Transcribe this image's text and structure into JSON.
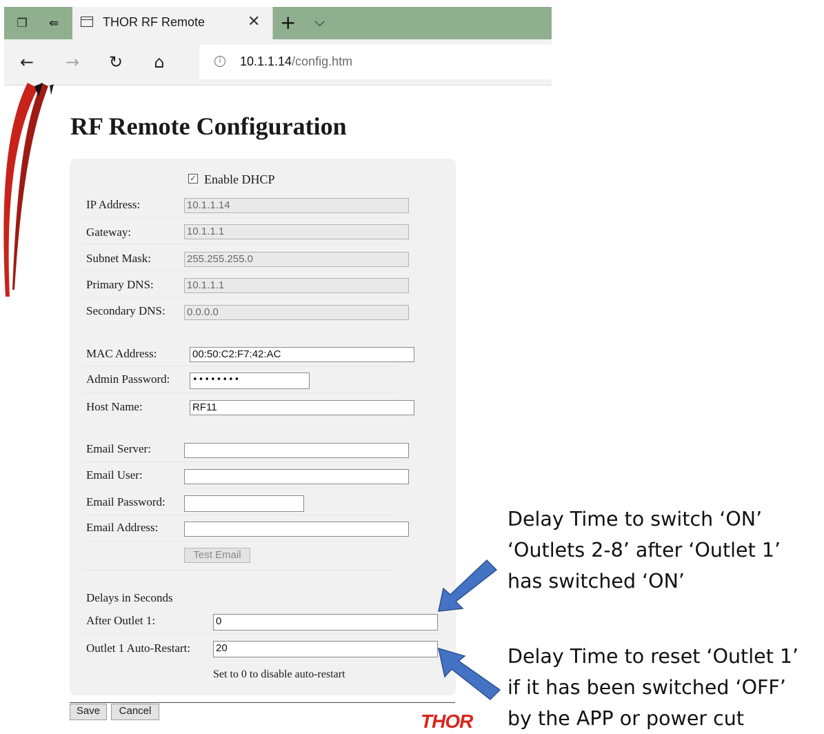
{
  "browser": {
    "tab_title": "THOR RF Remote",
    "url_host": "10.1.1.14",
    "url_path": "/config.htm",
    "icons": [
      "tab-actions-icon",
      "set-aside-tabs-icon",
      "page-icon",
      "close-icon",
      "new-tab-icon",
      "tab-list-icon",
      "back-icon",
      "forward-icon",
      "refresh-icon",
      "home-icon",
      "info-icon"
    ]
  },
  "page": {
    "title": "RF Remote Configuration",
    "dhcp": {
      "label": "Enable DHCP",
      "checked": true
    },
    "network": [
      {
        "label": "IP Address:",
        "value": "10.1.1.14"
      },
      {
        "label": "Gateway:",
        "value": "10.1.1.1"
      },
      {
        "label": "Subnet Mask:",
        "value": "255.255.255.0"
      },
      {
        "label": "Primary DNS:",
        "value": "10.1.1.1"
      },
      {
        "label": "Secondary DNS:",
        "value": "0.0.0.0"
      }
    ],
    "device": {
      "mac_label": "MAC Address:",
      "mac_value": "00:50:C2:F7:42:AC",
      "password_label": "Admin Password:",
      "password_value": "••••••••",
      "host_label": "Host Name:",
      "host_value": "RF11"
    },
    "email": {
      "server_label": "Email Server:",
      "server_value": "",
      "user_label": "Email User:",
      "user_value": "",
      "password_label": "Email Password:",
      "password_value": "",
      "address_label": "Email Address:",
      "address_value": "",
      "test_button": "Test Email"
    },
    "delays": {
      "heading": "Delays in Seconds",
      "after_outlet1_label": "After Outlet 1:",
      "after_outlet1_value": "0",
      "auto_restart_label": "Outlet 1 Auto-Restart:",
      "auto_restart_value": "20",
      "hint": "Set to 0 to disable auto-restart"
    },
    "save_button": "Save",
    "cancel_button": "Cancel",
    "logo_text": "THOR"
  },
  "annotations": {
    "callout1": [
      "Delay Time to switch  ‘ON’",
      "‘Outlets 2-8’ after ‘Outlet 1’",
      "has switched ‘ON’"
    ],
    "callout2": [
      "Delay Time to reset ‘Outlet 1’",
      "if it has been switched ‘OFF’",
      "by the APP or power cut"
    ]
  },
  "colors": {
    "tab_strip": "#8faf8f",
    "arrow": "#4472c4",
    "logo": "#d8261d"
  }
}
